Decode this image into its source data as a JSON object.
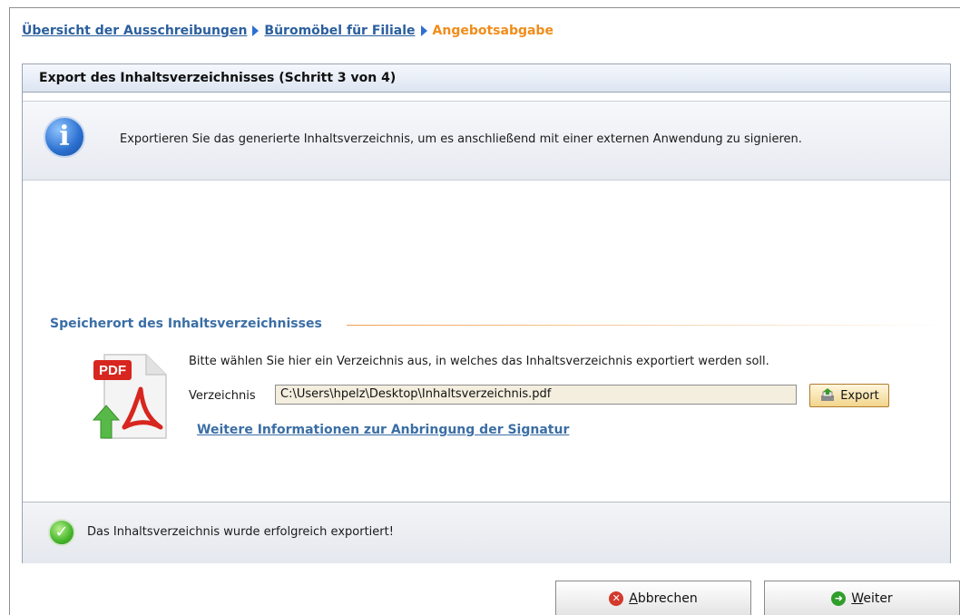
{
  "breadcrumb": {
    "item1": "Übersicht der Ausschreibungen",
    "item2": "Büromöbel für Filiale",
    "current": "Angebotsabgabe"
  },
  "panel": {
    "title": "Export des Inhaltsverzeichnisses (Schritt 3 von 4)",
    "info_text": "Exportieren Sie das generierte Inhaltsverzeichnis, um es anschließend mit einer externen Anwendung zu signieren."
  },
  "location": {
    "section_title": "Speicherort des Inhaltsverzeichnisses",
    "instruction": "Bitte wählen Sie hier ein Verzeichnis aus, in welches das Inhaltsverzeichnis exportiert werden soll.",
    "dir_label": "Verzeichnis",
    "dir_value": "C:\\Users\\hpelz\\Desktop\\Inhaltsverzeichnis.pdf",
    "export_label": "Export",
    "more_link": "Weitere Informationen zur Anbringung der Signatur",
    "pdf_badge": "PDF"
  },
  "status": {
    "message": "Das Inhaltsverzeichnis wurde erfolgreich exportiert!"
  },
  "buttons": {
    "cancel": "Abbrechen",
    "next": "Weiter"
  },
  "colors": {
    "link": "#2b5f9e",
    "current": "#f08c1a",
    "accent_line": "#f0a050"
  }
}
